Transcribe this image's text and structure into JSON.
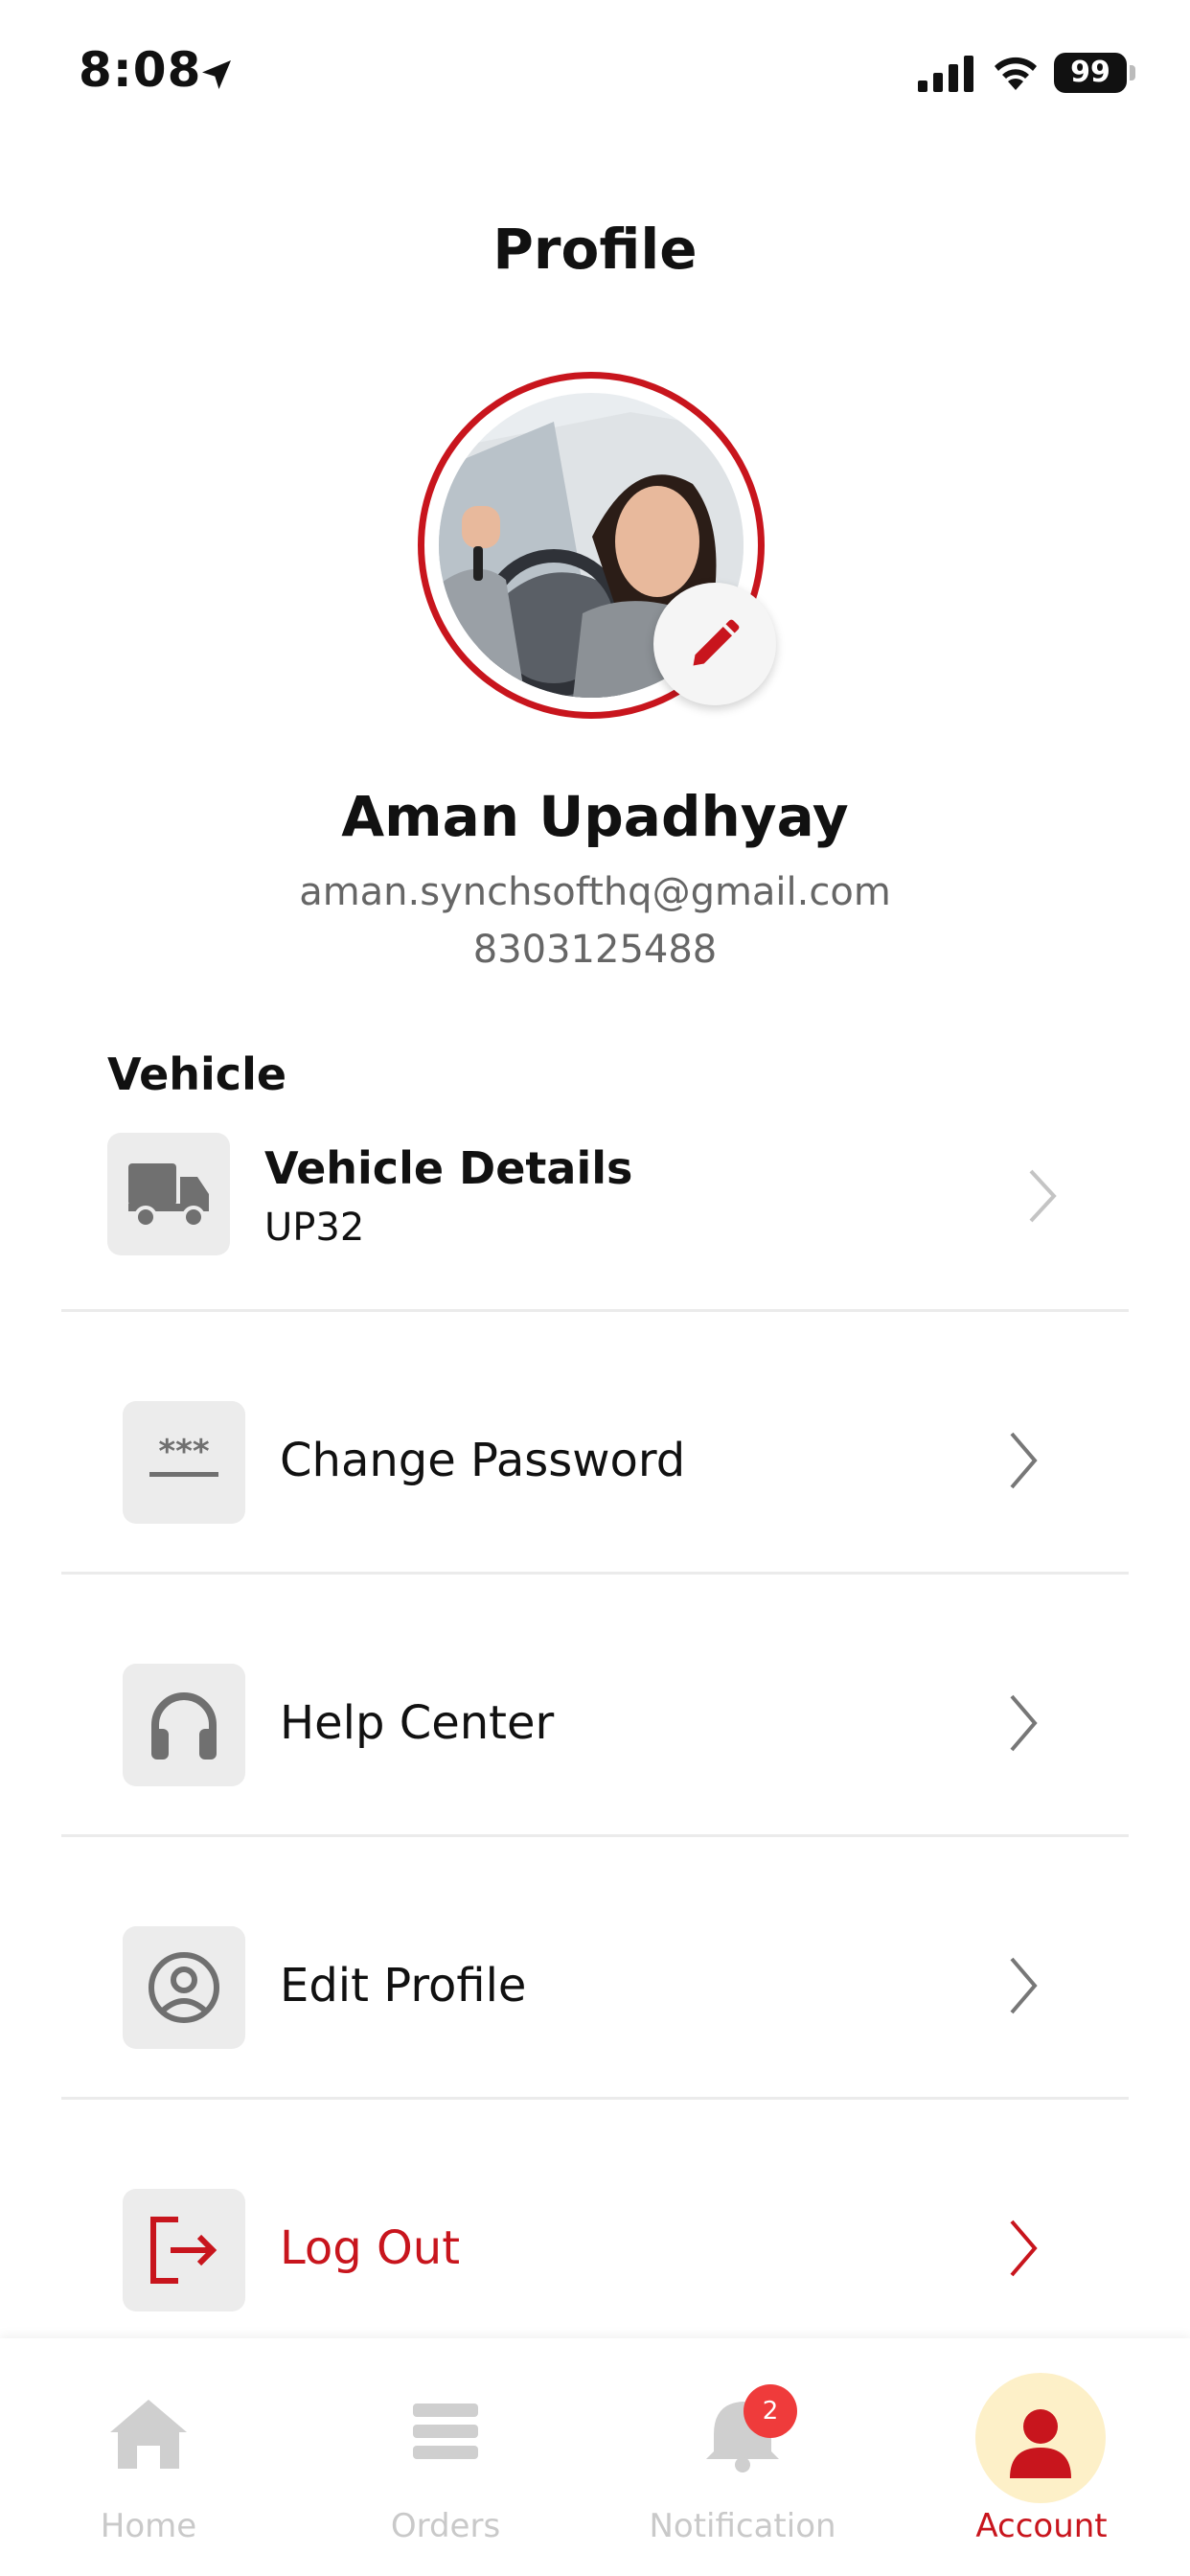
{
  "status_bar": {
    "time": "8:08",
    "battery": "99"
  },
  "header": {
    "title": "Profile"
  },
  "profile": {
    "name": "Aman Upadhyay",
    "email": "aman.synchsofthq@gmail.com",
    "phone": "8303125488"
  },
  "vehicle": {
    "section_label": "Vehicle",
    "title": "Vehicle Details",
    "subtitle": "UP32"
  },
  "menu": [
    {
      "label": "Change Password",
      "icon": "password-icon"
    },
    {
      "label": "Help Center",
      "icon": "headphones-icon"
    },
    {
      "label": "Edit Profile",
      "icon": "user-circle-icon"
    },
    {
      "label": "Log Out",
      "icon": "logout-icon"
    }
  ],
  "bottom_nav": {
    "items": [
      {
        "label": "Home",
        "icon": "home-icon"
      },
      {
        "label": "Orders",
        "icon": "orders-icon"
      },
      {
        "label": "Notification",
        "icon": "bell-icon",
        "badge": "2"
      },
      {
        "label": "Account",
        "icon": "user-icon",
        "active": true
      }
    ]
  },
  "colors": {
    "accent": "#c8151d",
    "inactive": "#c9c9c9",
    "icon_bg": "#ececec",
    "account_bg": "#fdf0c8"
  }
}
